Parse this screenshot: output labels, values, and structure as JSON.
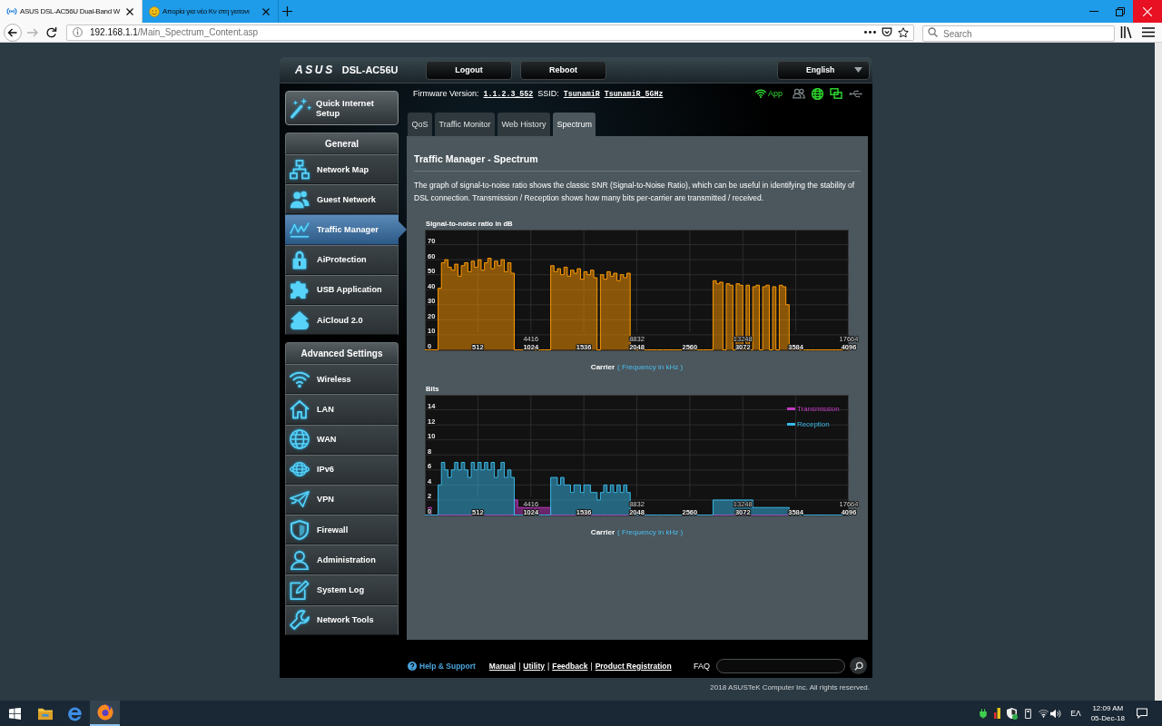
{
  "browser": {
    "tabs": [
      {
        "title": "ASUS DSL-AC56U Dual-Band W",
        "selected": true
      },
      {
        "title": "Απορία για νέο Κν στη γειτονι",
        "selected": false
      }
    ],
    "url": {
      "host": "192.168.1.1",
      "path": "/Main_Spectrum_Content.asp"
    },
    "search": {
      "placeholder": "Search"
    }
  },
  "router": {
    "header": {
      "logo": "ASUS",
      "model": "DSL-AC56U",
      "buttons": [
        "Logout",
        "Reboot"
      ],
      "language": "English"
    },
    "quick_setup": "Quick Internet Setup",
    "menu_groups": [
      {
        "title": "General",
        "items": [
          {
            "label": "Network Map",
            "selected": false
          },
          {
            "label": "Guest Network",
            "selected": false
          },
          {
            "label": "Traffic Manager",
            "selected": true
          },
          {
            "label": "AiProtection",
            "selected": false
          },
          {
            "label": "USB Application",
            "selected": false
          },
          {
            "label": "AiCloud 2.0",
            "selected": false
          }
        ]
      },
      {
        "title": "Advanced Settings",
        "items": [
          {
            "label": "Wireless",
            "selected": false
          },
          {
            "label": "LAN",
            "selected": false
          },
          {
            "label": "WAN",
            "selected": false
          },
          {
            "label": "IPv6",
            "selected": false
          },
          {
            "label": "VPN",
            "selected": false
          },
          {
            "label": "Firewall",
            "selected": false
          },
          {
            "label": "Administration",
            "selected": false
          },
          {
            "label": "System Log",
            "selected": false
          },
          {
            "label": "Network Tools",
            "selected": false
          }
        ]
      }
    ],
    "info": {
      "firmware_label": "Firmware Version:",
      "firmware": "1.1.2.3_552",
      "ssid_label": "SSID:",
      "ssids": [
        "TsunamiR",
        "TsunamiR_5GHz"
      ],
      "app": "App",
      "status_icons": [
        {
          "on": false
        },
        {
          "on": true
        },
        {
          "on": true
        },
        {
          "on": false
        }
      ]
    },
    "tabs": [
      {
        "label": "QoS",
        "selected": false
      },
      {
        "label": "Traffic Monitor",
        "selected": false
      },
      {
        "label": "Web History",
        "selected": false
      },
      {
        "label": "Spectrum",
        "selected": true
      }
    ],
    "panel": {
      "title": "Traffic Manager - Spectrum",
      "description": "The graph of signal-to-noise ratio shows the classic SNR (Signal-to-Noise Ratio), which can be useful in identifying the stability of DSL connection. Transmission / Reception shows how many bits per-carrier are transmitted / received.",
      "charts": [
        {
          "xlabel_unit": "( Frequency in kHz )",
          "chart_data": {
            "type": "area",
            "title": "Signal-to-noise ratio in dB",
            "xlabel": "Carrier",
            "x": [
              0,
              32,
              64,
              96,
              128,
              160,
              192,
              224,
              256,
              288,
              320,
              352,
              384,
              416,
              448,
              480,
              512,
              544,
              576,
              608,
              640,
              672,
              704,
              736,
              768,
              800,
              832,
              864,
              896,
              928,
              960,
              992,
              1024,
              1056,
              1088,
              1120,
              1152,
              1184,
              1216,
              1248,
              1280,
              1312,
              1344,
              1376,
              1408,
              1440,
              1472,
              1504,
              1536,
              1568,
              1600,
              1632,
              1664,
              1696,
              1728,
              1760,
              1792,
              1824,
              1856,
              1888,
              1920,
              1952,
              1984,
              2016,
              2048,
              2080,
              2112,
              2144,
              2176,
              2208,
              2240,
              2272,
              2304,
              2336,
              2368,
              2400,
              2432,
              2464,
              2496,
              2528,
              2560,
              2592,
              2624,
              2656,
              2688,
              2720,
              2752,
              2784,
              2816,
              2848,
              2880,
              2912,
              2944,
              2976,
              3008,
              3040,
              3072,
              3104,
              3136,
              3168,
              3200,
              3232,
              3264,
              3296,
              3328,
              3360,
              3392,
              3424,
              3456,
              3488,
              3520,
              3552,
              3584,
              3616,
              3648,
              3680,
              3712,
              3744,
              3776,
              3808,
              3840,
              3872,
              3904,
              3936,
              3968,
              4000,
              4032,
              4064,
              4096
            ],
            "values": [
              0,
              0,
              0,
              0,
              41,
              58,
              60,
              55,
              53,
              57,
              49,
              56,
              58,
              52,
              59,
              55,
              60,
              53,
              58,
              61,
              54,
              59,
              56,
              60,
              52,
              58,
              51,
              0,
              0,
              0,
              0,
              0,
              0,
              0,
              0,
              0,
              0,
              0,
              56,
              52,
              54,
              50,
              55,
              49,
              53,
              51,
              54,
              47,
              52,
              50,
              53,
              48,
              0,
              50,
              47,
              52,
              49,
              51,
              46,
              50,
              48,
              51,
              0,
              0,
              0,
              0,
              0,
              0,
              0,
              0,
              0,
              0,
              0,
              0,
              0,
              0,
              0,
              0,
              0,
              0,
              0,
              0,
              0,
              0,
              0,
              0,
              0,
              46,
              44,
              45,
              0,
              44,
              43,
              0,
              44,
              43,
              0,
              43,
              0,
              42,
              43,
              0,
              42,
              43,
              0,
              42,
              0,
              43,
              42,
              30,
              0,
              0,
              0,
              0,
              0,
              0,
              0,
              0,
              0,
              0,
              0,
              0,
              0,
              0,
              0,
              0,
              0,
              0,
              0
            ],
            "xlim": [
              0,
              4096
            ],
            "ylim": [
              0,
              80
            ],
            "xticks": [
              512,
              1024,
              1536,
              2048,
              2560,
              3072,
              3584,
              4096
            ],
            "yticks": [
              0,
              10,
              20,
              30,
              40,
              50,
              60,
              70
            ],
            "grid": true,
            "annotations": [
              "4416",
              "8832",
              "13248",
              "17664"
            ]
          }
        },
        {
          "xlabel_unit": "( Frequency in kHz )",
          "chart_data": {
            "type": "area",
            "title": "Bits",
            "xlabel": "Carrier",
            "x": [
              0,
              32,
              64,
              96,
              128,
              160,
              192,
              224,
              256,
              288,
              320,
              352,
              384,
              416,
              448,
              480,
              512,
              544,
              576,
              608,
              640,
              672,
              704,
              736,
              768,
              800,
              832,
              864,
              896,
              928,
              960,
              992,
              1024,
              1056,
              1088,
              1120,
              1152,
              1184,
              1216,
              1248,
              1280,
              1312,
              1344,
              1376,
              1408,
              1440,
              1472,
              1504,
              1536,
              1568,
              1600,
              1632,
              1664,
              1696,
              1728,
              1760,
              1792,
              1824,
              1856,
              1888,
              1920,
              1952,
              1984,
              2016,
              2048,
              2080,
              2112,
              2144,
              2176,
              2208,
              2240,
              2272,
              2304,
              2336,
              2368,
              2400,
              2432,
              2464,
              2496,
              2528,
              2560,
              2592,
              2624,
              2656,
              2688,
              2720,
              2752,
              2784,
              2816,
              2848,
              2880,
              2912,
              2944,
              2976,
              3008,
              3040,
              3072,
              3104,
              3136,
              3168,
              3200,
              3232,
              3264,
              3296,
              3328,
              3360,
              3392,
              3424,
              3456,
              3488,
              3520,
              3552,
              3584,
              3616,
              3648,
              3680,
              3712,
              3744,
              3776,
              3808,
              3840,
              3872,
              3904,
              3936,
              3968,
              4000,
              4032,
              4064,
              4096
            ],
            "series": [
              {
                "name": "Transmission",
                "color": "#c23ac2",
                "values": [
                  0,
                  1,
                  0,
                  0,
                  0,
                  0,
                  0,
                  0,
                  0,
                  0,
                  0,
                  0,
                  0,
                  0,
                  0,
                  0,
                  0,
                  0,
                  0,
                  0,
                  0,
                  0,
                  0,
                  0,
                  0,
                  0,
                  0,
                  2,
                  1,
                  1,
                  1,
                  1,
                  1,
                  1,
                  1,
                  1,
                  1,
                  1,
                  0,
                  0,
                  0,
                  0,
                  0,
                  0,
                  0,
                  0,
                  0,
                  0,
                  0,
                  0,
                  0,
                  0,
                  0,
                  0,
                  0,
                  0,
                  0,
                  0,
                  0,
                  0,
                  0,
                  0,
                  0,
                  0,
                  0,
                  0,
                  0,
                  0,
                  0,
                  0,
                  0,
                  0,
                  0,
                  0,
                  0,
                  0,
                  0,
                  0,
                  0,
                  0,
                  0,
                  0,
                  0,
                  0,
                  0,
                  0,
                  0,
                  0,
                  0,
                  0,
                  0,
                  0,
                  0,
                  0,
                  0,
                  0,
                  0,
                  0,
                  0,
                  0,
                  0,
                  0,
                  0,
                  0,
                  0,
                  0,
                  0,
                  0,
                  0,
                  0,
                  0,
                  0,
                  0,
                  0,
                  0,
                  0,
                  0,
                  0,
                  0,
                  0,
                  0,
                  0,
                  0,
                  0,
                  0,
                  0,
                  0,
                  0,
                  0
                ]
              },
              {
                "name": "Reception",
                "color": "#38b8e8",
                "values": [
                  0,
                  0,
                  0,
                  0,
                  4,
                  7,
                  6,
                  5,
                  6,
                  7,
                  6,
                  7,
                  6,
                  5,
                  7,
                  6,
                  7,
                  6,
                  7,
                  6,
                  7,
                  5,
                  6,
                  7,
                  5,
                  6,
                  5,
                  0,
                  0,
                  0,
                  0,
                  0,
                  0,
                  0,
                  0,
                  0,
                  0,
                  0,
                  5,
                  5,
                  4,
                  5,
                  4,
                  4,
                  3,
                  4,
                  4,
                  3,
                  4,
                  4,
                  3,
                  3,
                  2,
                  3,
                  4,
                  3,
                  4,
                  3,
                  4,
                  3,
                  4,
                  3,
                  0,
                  0,
                  0,
                  0,
                  0,
                  0,
                  0,
                  0,
                  0,
                  0,
                  0,
                  0,
                  0,
                  0,
                  0,
                  0,
                  0,
                  0,
                  0,
                  0,
                  0,
                  0,
                  0,
                  0,
                  0,
                  2,
                  2,
                  2,
                  2,
                  2,
                  2,
                  2,
                  2,
                  2,
                  2,
                  2,
                  2,
                  1,
                  1,
                  1,
                  1,
                  1,
                  1,
                  1,
                  1,
                  1,
                  1,
                  1,
                  0,
                  0,
                  0,
                  0,
                  0,
                  0,
                  0,
                  0,
                  0,
                  0,
                  0,
                  0,
                  0,
                  0,
                  0,
                  0,
                  0,
                  0,
                  0
                ]
              }
            ],
            "xlim": [
              0,
              4096
            ],
            "ylim": [
              0,
              16
            ],
            "xticks": [
              512,
              1024,
              1536,
              2048,
              2560,
              3072,
              3584,
              4096
            ],
            "yticks": [
              0,
              2,
              4,
              6,
              8,
              10,
              12,
              14
            ],
            "grid": true,
            "legend": "upper right",
            "annotations": [
              "4416",
              "8832",
              "13248",
              "17664"
            ]
          }
        }
      ]
    },
    "footer": {
      "help": "Help & Support",
      "links": [
        "Manual",
        "Utility",
        "Feedback",
        "Product Registration"
      ],
      "separator": "|",
      "faq": "FAQ"
    },
    "copyright": "2018 ASUSTeK Computer Inc. All rights reserved."
  },
  "taskbar": {
    "apps": [
      {
        "active": false
      },
      {
        "active": false
      },
      {
        "active": true
      }
    ],
    "language": "ΕΛ",
    "time": "12:09 AM",
    "date": "05-Dec-18"
  }
}
